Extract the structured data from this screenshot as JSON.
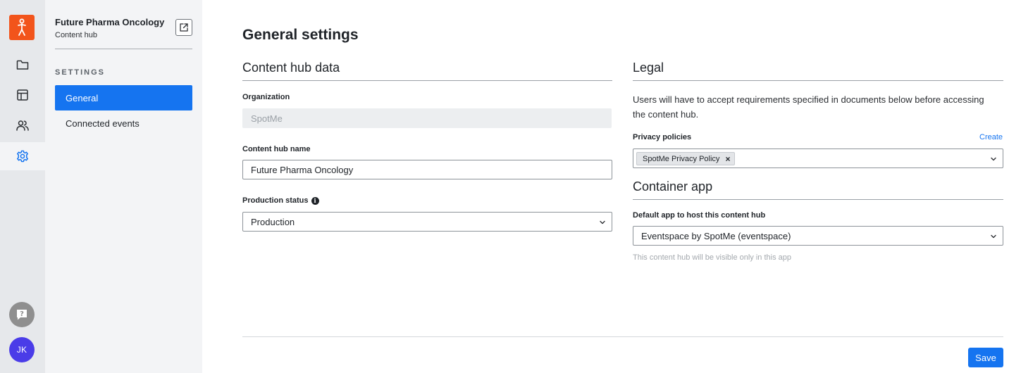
{
  "rail": {
    "logo_icon": "spotme-person-icon",
    "items": [
      {
        "icon": "folder-icon",
        "name": "rail-folder"
      },
      {
        "icon": "layout-icon",
        "name": "rail-layout"
      },
      {
        "icon": "users-icon",
        "name": "rail-users"
      },
      {
        "icon": "gear-icon",
        "name": "rail-settings",
        "active": true
      }
    ],
    "help_icon": "help-chat-icon",
    "avatar_initials": "JK"
  },
  "sidebar": {
    "hub_name": "Future Pharma Oncology",
    "hub_subtitle": "Content hub",
    "section_heading": "SETTINGS",
    "items": [
      {
        "label": "General",
        "active": true
      },
      {
        "label": "Connected events",
        "active": false
      }
    ]
  },
  "main": {
    "title": "General settings",
    "content_hub_data": {
      "title": "Content hub data",
      "organization_label": "Organization",
      "organization_value": "SpotMe",
      "hub_name_label": "Content hub name",
      "hub_name_value": "Future Pharma Oncology",
      "production_status_label": "Production status",
      "production_status_value": "Production"
    },
    "legal": {
      "title": "Legal",
      "description": "Users will have to accept requirements specified in documents below before accessing the content hub.",
      "privacy_label": "Privacy policies",
      "create_label": "Create",
      "privacy_chip": "SpotMe Privacy Policy"
    },
    "container_app": {
      "title": "Container app",
      "default_app_label": "Default app to host this content hub",
      "default_app_value": "Eventspace by SpotMe (eventspace)",
      "hint": "This content hub will be visible only in this app"
    },
    "save_label": "Save"
  },
  "colors": {
    "accent": "#1574f0",
    "logo": "#f2541b",
    "avatar": "#4a3ce8"
  }
}
